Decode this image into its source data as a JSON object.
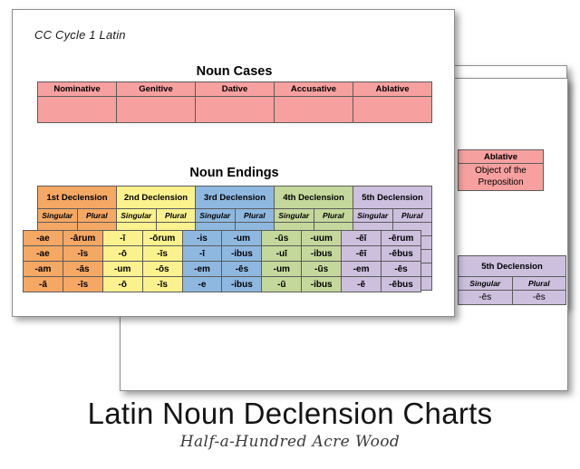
{
  "poster": {
    "main_title": "Latin Noun Declension Charts",
    "sub_title": "Half-a-Hundred Acre Wood"
  },
  "front_sheet": {
    "doc_label": "CC Cycle 1 Latin",
    "noun_cases": {
      "title": "Noun Cases",
      "headers": [
        "Nominative",
        "Genitive",
        "Dative",
        "Accusative",
        "Ablative"
      ],
      "body_rows": 1,
      "cell_color": "#f7a0a0"
    },
    "noun_endings": {
      "title": "Noun Endings",
      "declensions": [
        {
          "label": "1st Declension",
          "color": "#f5a863"
        },
        {
          "label": "2nd Declension",
          "color": "#fbf28e"
        },
        {
          "label": "3rd Declension",
          "color": "#8fb8e0"
        },
        {
          "label": "4th Declension",
          "color": "#c4d89b"
        },
        {
          "label": "5th Declension",
          "color": "#ccc0de"
        }
      ],
      "number_headers": [
        "Singular",
        "Plural"
      ],
      "body_rows": 5
    }
  },
  "middle_sheet": {
    "ablative_box": {
      "header": "Ablative",
      "description": "Object of the Preposition",
      "color": "#f7a0a0"
    },
    "fifth_declension_box": {
      "header": "5th Declension",
      "number_headers": [
        "Singular",
        "Plural"
      ],
      "color": "#ccc0de",
      "rows": [
        [
          "-ēs",
          "-ēs"
        ]
      ]
    },
    "endings_filled": {
      "columns": [
        {
          "declension": "1st Declension",
          "number": "Singular",
          "color": "#f5a863"
        },
        {
          "declension": "1st Declension",
          "number": "Plural",
          "color": "#f5a863"
        },
        {
          "declension": "2nd Declension",
          "number": "Singular",
          "color": "#fbf28e"
        },
        {
          "declension": "2nd Declension",
          "number": "Plural",
          "color": "#fbf28e"
        },
        {
          "declension": "3rd Declension",
          "number": "Singular",
          "color": "#8fb8e0"
        },
        {
          "declension": "3rd Declension",
          "number": "Plural",
          "color": "#8fb8e0"
        },
        {
          "declension": "4th Declension",
          "number": "Singular",
          "color": "#c4d89b"
        },
        {
          "declension": "4th Declension",
          "number": "Plural",
          "color": "#c4d89b"
        },
        {
          "declension": "5th Declension",
          "number": "Singular",
          "color": "#ccc0de"
        },
        {
          "declension": "5th Declension",
          "number": "Plural",
          "color": "#ccc0de"
        }
      ],
      "rows": [
        [
          "-ae",
          "-ārum",
          "-ī",
          "-ōrum",
          "-is",
          "-um",
          "-ūs",
          "-uum",
          "-ēī",
          "-ērum"
        ],
        [
          "-ae",
          "-īs",
          "-ō",
          "-īs",
          "-ī",
          "-ibus",
          "-uī",
          "-ibus",
          "-ēī",
          "-ēbus"
        ],
        [
          "-am",
          "-ās",
          "-um",
          "-ōs",
          "-em",
          "-ēs",
          "-um",
          "-ūs",
          "-em",
          "-ēs"
        ],
        [
          "-ā",
          "-īs",
          "-ō",
          "-īs",
          "-e",
          "-ibus",
          "-ū",
          "-ibus",
          "-ē",
          "-ēbus"
        ]
      ]
    }
  }
}
